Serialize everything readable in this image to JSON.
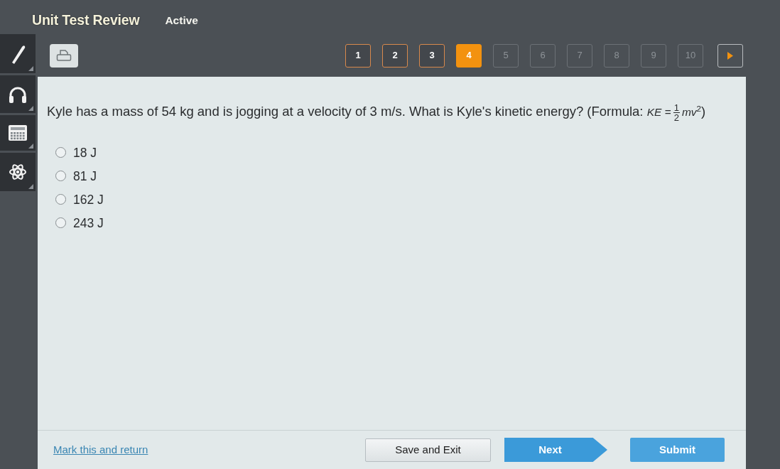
{
  "header": {
    "title": "Unit Test Review",
    "status": "Active"
  },
  "pages": [
    {
      "label": "1",
      "answered": true,
      "selected": false
    },
    {
      "label": "2",
      "answered": true,
      "selected": false
    },
    {
      "label": "3",
      "answered": true,
      "selected": false
    },
    {
      "label": "4",
      "answered": false,
      "selected": true
    },
    {
      "label": "5",
      "answered": false,
      "selected": false
    },
    {
      "label": "6",
      "answered": false,
      "selected": false
    },
    {
      "label": "7",
      "answered": false,
      "selected": false
    },
    {
      "label": "8",
      "answered": false,
      "selected": false
    },
    {
      "label": "9",
      "answered": false,
      "selected": false
    },
    {
      "label": "10",
      "answered": false,
      "selected": false
    }
  ],
  "question": {
    "text": "Kyle has a mass of 54 kg and is jogging at a velocity of 3 m/s. What is Kyle's kinetic energy? (Formula:",
    "formula": {
      "left": "*KE* =",
      "numerator": "1",
      "denominator": "2",
      "right": "*mv*$^{2}$"
    },
    "after": ")"
  },
  "options": [
    {
      "label": "18 J",
      "selected": false
    },
    {
      "label": "81 J",
      "selected": false
    },
    {
      "label": "162 J",
      "selected": false
    },
    {
      "label": "243 J",
      "selected": false
    }
  ],
  "footer": {
    "mark_link": "Mark this and return",
    "save_button": "Save and Exit",
    "next_button": "Next",
    "submit_button": "Submit"
  }
}
